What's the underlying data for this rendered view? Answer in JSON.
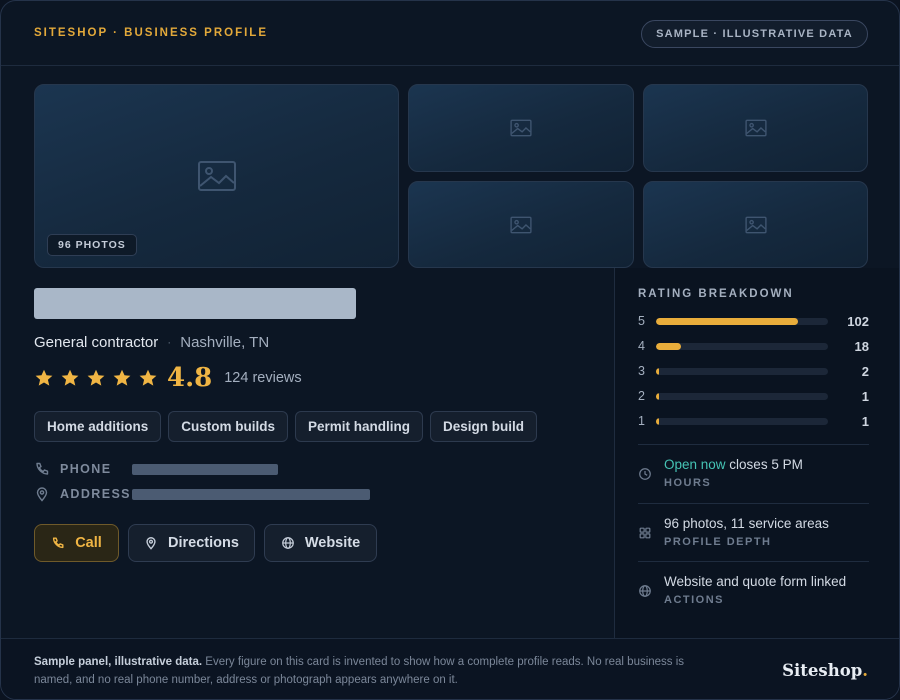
{
  "header": {
    "eyebrow": "SITESHOP · BUSINESS PROFILE",
    "badge": "SAMPLE · ILLUSTRATIVE DATA"
  },
  "gallery": {
    "photo_count_label": "96 PHOTOS",
    "tiles": [
      "image-placeholder-icon",
      "image-placeholder-icon",
      "image-placeholder-icon",
      "image-placeholder-icon",
      "image-placeholder-icon"
    ]
  },
  "business": {
    "category": "General contractor",
    "separator": "·",
    "location": "Nashville, TN",
    "stars": 5,
    "score": "4.8",
    "reviews": "124 reviews"
  },
  "tags": [
    "Home additions",
    "Custom builds",
    "Permit handling",
    "Design build"
  ],
  "contact": {
    "phone_label": "PHONE",
    "address_label": "ADDRESS"
  },
  "actions": {
    "call": "Call",
    "directions": "Directions",
    "website": "Website"
  },
  "rating_breakdown": {
    "title": "RATING BREAKDOWN",
    "rows": [
      {
        "star": "5",
        "count": "102",
        "fraction": 0.823
      },
      {
        "star": "4",
        "count": "18",
        "fraction": 0.145
      },
      {
        "star": "3",
        "count": "2",
        "fraction": 0.016
      },
      {
        "star": "2",
        "count": "1",
        "fraction": 0.008
      },
      {
        "star": "1",
        "count": "1",
        "fraction": 0.008
      }
    ]
  },
  "info": {
    "hours_open": "Open now",
    "hours_close": " closes 5 PM",
    "hours_label": "HOURS",
    "depth_text": "96 photos, 11 service areas",
    "depth_label": "PROFILE DEPTH",
    "actions_text": "Website and quote form linked",
    "actions_label": "ACTIONS"
  },
  "footer": {
    "note_bold": "Sample panel, illustrative data.",
    "note_rest": " Every figure on this card is invented to show how a complete profile reads. No real business is named, and no real phone number, address or photograph appears anywhere on it.",
    "logo": "Siteshop",
    "logo_dot": "."
  },
  "colors": {
    "accent": "#e3a93a",
    "open_status": "#45c3b4",
    "background": "#0c1624"
  }
}
